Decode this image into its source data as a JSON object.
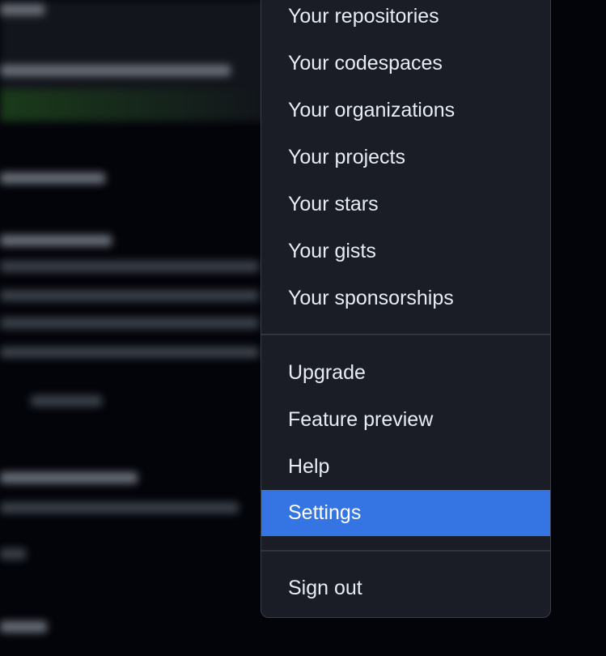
{
  "menu": {
    "items": [
      {
        "label": "Your repositories"
      },
      {
        "label": "Your codespaces"
      },
      {
        "label": "Your organizations"
      },
      {
        "label": "Your projects"
      },
      {
        "label": "Your stars"
      },
      {
        "label": "Your gists"
      },
      {
        "label": "Your sponsorships"
      },
      {
        "label": "Upgrade"
      },
      {
        "label": "Feature preview"
      },
      {
        "label": "Help"
      },
      {
        "label": "Settings",
        "highlighted": true
      },
      {
        "label": "Sign out"
      }
    ]
  },
  "colors": {
    "highlight": "#3574e3",
    "menu_bg": "#1a1d25",
    "text": "#e6edf3"
  }
}
